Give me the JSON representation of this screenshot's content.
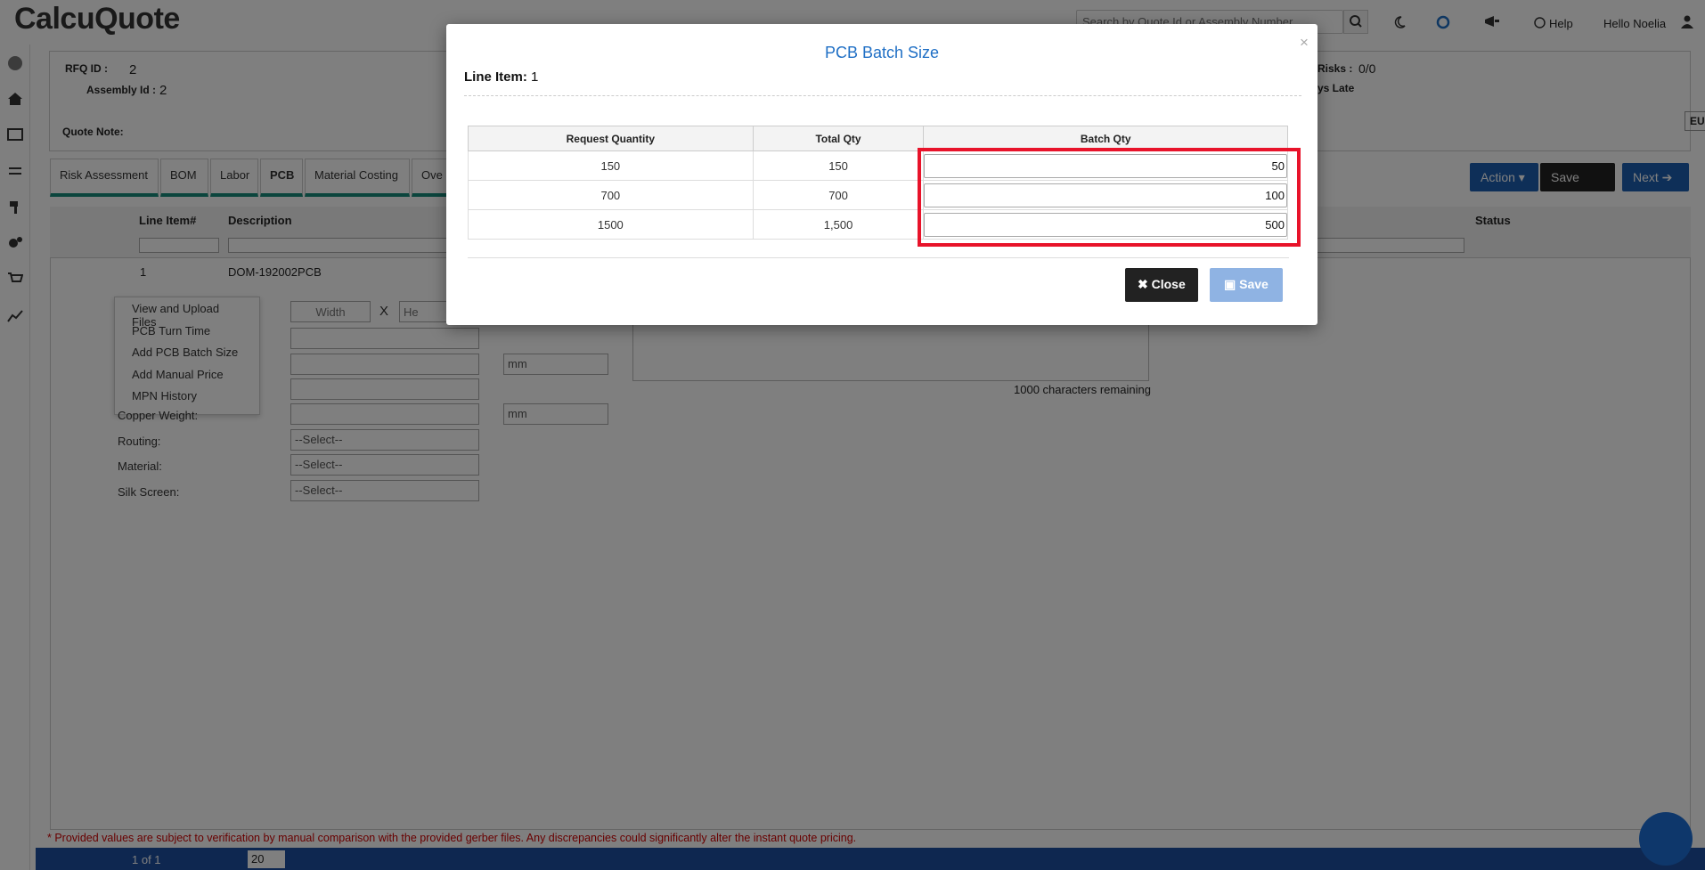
{
  "app": {
    "title": "CalcuQuote",
    "search_placeholder": "Search by Quote Id or Assembly Number",
    "help": "Help",
    "user": "Hello Noelia"
  },
  "header": {
    "rfq_label": "RFQ ID :",
    "rfq_value": "2",
    "assembly_label": "Assembly Id :",
    "assembly_value": "2",
    "risks_label": "Risks :",
    "risks_value": "0/0",
    "late_label": "ys Late",
    "quote_note_label": "Quote Note:",
    "currency": "EUR"
  },
  "tabs": [
    "Risk Assessment",
    "BOM",
    "Labor",
    "PCB",
    "Material Costing",
    "Ove"
  ],
  "toolbar": {
    "action": "Action",
    "save": "Save",
    "next": "Next"
  },
  "grid": {
    "columns": [
      "Line Item#",
      "Description",
      "Status"
    ],
    "row": {
      "line": "1",
      "description": "DOM-192002PCB"
    }
  },
  "context_menu": [
    "View and Upload Files",
    "PCB Turn Time",
    "Add PCB Batch Size",
    "Add Manual Price",
    "MPN History"
  ],
  "form": {
    "width_placeholder": "Width",
    "x": "X",
    "height_placeholder": "He",
    "unit1": "mm",
    "unit2": "mm",
    "copper_label": "Copper Weight:",
    "routing_label": "Routing:",
    "material_label": "Material:",
    "silk_label": "Silk Screen:",
    "select_placeholder": "--Select--",
    "chars_remaining": "1000 characters remaining"
  },
  "disclaimer": "* Provided values are subject to verification by manual comparison with the provided gerber files. Any discrepancies could significantly alter the instant quote pricing.",
  "pager": {
    "page": "1 of 1",
    "size": "20"
  },
  "modal": {
    "title": "PCB Batch Size",
    "line_label": "Line Item:",
    "line_value": "1",
    "headers": [
      "Request Quantity",
      "Total Qty",
      "Batch Qty"
    ],
    "rows": [
      {
        "request": "150",
        "total": "150",
        "batch": "50"
      },
      {
        "request": "700",
        "total": "700",
        "batch": "100"
      },
      {
        "request": "1500",
        "total": "1,500",
        "batch": "500"
      }
    ],
    "close": "Close",
    "save": "Save"
  },
  "colors": {
    "accent": "#1f6fc5",
    "highlight": "#e8132a",
    "tab_underline": "#178a7a",
    "footer": "#1d4fa0"
  }
}
